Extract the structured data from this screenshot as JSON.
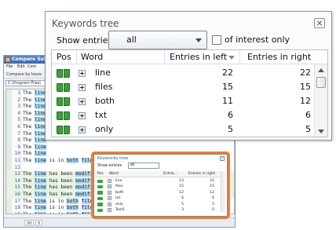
{
  "app": {
    "title": "Compare Suite",
    "menu": [
      "File",
      "Edit",
      "Com"
    ],
    "toolbar_text": "Compare  by keyw",
    "path": "C:\\Program Files\\",
    "status": [
      "20",
      "5"
    ],
    "lines": [
      {
        "num": "1",
        "parts": [
          [
            "The ",
            ""
          ],
          [
            "line",
            "kw"
          ]
        ]
      },
      {
        "num": "2",
        "parts": [
          [
            "The ",
            ""
          ],
          [
            "line",
            "kw"
          ]
        ]
      },
      {
        "num": "3",
        "parts": [
          [
            "The ",
            ""
          ],
          [
            "line",
            "kw"
          ]
        ]
      },
      {
        "num": "4",
        "parts": [
          [
            "The ",
            ""
          ],
          [
            "line",
            "kw"
          ]
        ]
      },
      {
        "num": "5",
        "parts": [
          [
            "The ",
            ""
          ],
          [
            "line",
            "kw"
          ]
        ]
      },
      {
        "num": "6",
        "parts": [
          [
            "The ",
            ""
          ],
          [
            "line",
            "kw"
          ]
        ]
      },
      {
        "num": "7",
        "parts": [
          [
            "The ",
            ""
          ],
          [
            "line",
            "kw"
          ]
        ]
      },
      {
        "num": "8",
        "parts": [
          [
            "The ",
            ""
          ],
          [
            "line",
            "kw"
          ]
        ]
      },
      {
        "num": "9",
        "parts": [
          [
            "The ",
            ""
          ],
          [
            "line",
            "kw"
          ]
        ]
      },
      {
        "num": "10",
        "parts": [
          [
            "The ",
            ""
          ],
          [
            "line",
            "kw"
          ]
        ]
      },
      {
        "num": "11",
        "parts": [
          [
            "The ",
            ""
          ],
          [
            "line",
            "kw"
          ],
          [
            " is in ",
            ""
          ],
          [
            "both",
            "kw"
          ],
          [
            " ",
            ""
          ],
          [
            "files",
            "kw"
          ],
          [
            ".",
            ""
          ]
        ]
      },
      {
        "num": "12",
        "parts": [
          [
            "",
            ""
          ]
        ]
      },
      {
        "num": "13",
        "parts": [
          [
            "The ",
            ""
          ],
          [
            "line",
            "kw"
          ],
          [
            " has been ",
            ""
          ],
          [
            "modified",
            "kw"
          ],
          [
            ".",
            ""
          ]
        ]
      },
      {
        "num": "14",
        "parts": [
          [
            "The ",
            ""
          ],
          [
            "line",
            "kw"
          ],
          [
            " has been ",
            ""
          ],
          [
            "modified",
            "kw"
          ],
          [
            ".",
            ""
          ]
        ]
      },
      {
        "num": "15",
        "parts": [
          [
            "The ",
            ""
          ],
          [
            "line",
            "kw"
          ],
          [
            " has been ",
            ""
          ],
          [
            "modified",
            "kw"
          ],
          [
            ".",
            ""
          ]
        ]
      },
      {
        "num": "16",
        "parts": [
          [
            "The ",
            ""
          ],
          [
            "line",
            "kw"
          ],
          [
            " has been ",
            ""
          ],
          [
            "modified",
            "kw"
          ],
          [
            ".",
            ""
          ]
        ]
      },
      {
        "num": "17",
        "parts": [
          [
            "The ",
            ""
          ],
          [
            "line",
            "kw"
          ],
          [
            " is in ",
            ""
          ],
          [
            "both",
            "kw"
          ],
          [
            " ",
            ""
          ],
          [
            "files",
            "kw"
          ],
          [
            ".",
            ""
          ]
        ]
      },
      {
        "num": "18",
        "parts": [
          [
            "The ",
            ""
          ],
          [
            "line",
            "kw"
          ],
          [
            " is in ",
            ""
          ],
          [
            "both",
            "kw"
          ],
          [
            " ",
            ""
          ],
          [
            "files",
            "kw"
          ],
          [
            ".",
            ""
          ]
        ]
      },
      {
        "num": "19",
        "parts": [
          [
            "The ",
            ""
          ],
          [
            "line",
            "kw"
          ],
          [
            " is in ",
            ""
          ],
          [
            "both",
            "kw"
          ],
          [
            " ",
            ""
          ],
          [
            "files",
            "kw"
          ],
          [
            ".",
            ""
          ]
        ]
      },
      {
        "num": "20",
        "parts": [
          [
            "",
            ""
          ]
        ]
      },
      {
        "num": "21",
        "parts": [
          [
            "The ",
            ""
          ],
          [
            "line",
            "kw"
          ],
          [
            " differs only in ",
            ""
          ],
          [
            "wo",
            "kw"
          ]
        ]
      }
    ]
  },
  "mini_panel": {
    "title": "Keywords tree",
    "show_label": "Show entries",
    "select_value": "all",
    "headers": [
      "Pos",
      "Word",
      "Entrie...",
      "Entries in right"
    ],
    "rows": [
      {
        "word": "line",
        "left": "23",
        "right": "22"
      },
      {
        "word": "files",
        "left": "15",
        "right": "15"
      },
      {
        "word": "both",
        "left": "12",
        "right": "12"
      },
      {
        "word": "txt",
        "left": "6",
        "right": "6"
      },
      {
        "word": "only",
        "left": "5",
        "right": "5"
      },
      {
        "word": "Text1",
        "left": "3",
        "right": "0"
      }
    ]
  },
  "panel": {
    "title": "Keywords tree",
    "show_label": "Show entries",
    "select_value": "all",
    "interest_label": "of interest only",
    "interest_checked": false,
    "headers": {
      "pos": "Pos",
      "word": "Word",
      "left": "Entries in left",
      "right": "Entries in right"
    },
    "rows": [
      {
        "word": "line",
        "left": "22",
        "right": "22"
      },
      {
        "word": "files",
        "left": "15",
        "right": "15"
      },
      {
        "word": "both",
        "left": "11",
        "right": "12"
      },
      {
        "word": "txt",
        "left": "6",
        "right": "6"
      },
      {
        "word": "only",
        "left": "5",
        "right": "5"
      }
    ]
  },
  "colors": {
    "highlight": "#f07d2e",
    "keyword": "#a9d7f5",
    "book_icon": "#3c9f3c"
  }
}
